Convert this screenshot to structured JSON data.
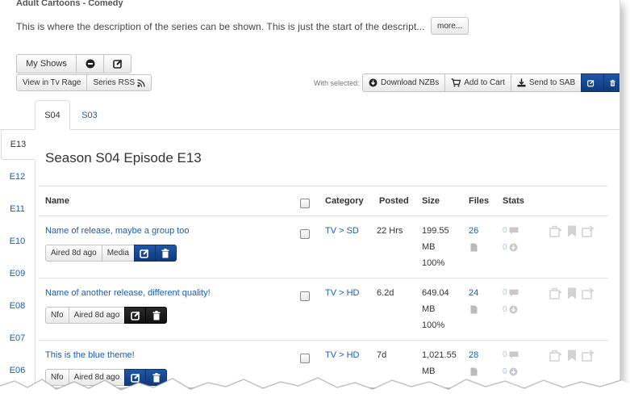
{
  "breadcrumb": "Adult Cartoons - Comedy",
  "description": "This is where the description of the series can be shown. This is just the start of the descript...",
  "more_label": "more...",
  "my_shows_label": "My Shows",
  "links": {
    "tvrage": "View in Tv Rage",
    "rss": "Series RSS"
  },
  "with_selected_label": "With selected:",
  "actions": {
    "download": "Download NZBs",
    "cart": "Add to Cart",
    "sab": "Send to SAB"
  },
  "seasons": [
    {
      "label": "S04",
      "active": true
    },
    {
      "label": "S03",
      "active": false
    }
  ],
  "episodes": [
    "E13",
    "E12",
    "E11",
    "E10",
    "E09",
    "E08",
    "E07",
    "E06"
  ],
  "active_episode": "E13",
  "heading": "Season S04 Episode E13",
  "columns": {
    "name": "Name",
    "category": "Category",
    "posted": "Posted",
    "size": "Size",
    "files": "Files",
    "stats": "Stats"
  },
  "releases": [
    {
      "name": "Name of release, maybe a group too",
      "tags": [
        "Aired 8d ago",
        "Media"
      ],
      "category": "TV > SD",
      "posted": "22 Hrs",
      "size_lines": [
        "199.55",
        "MB",
        "100%"
      ],
      "files": "26",
      "stat_a": "0",
      "stat_b": "0",
      "theme": "blue"
    },
    {
      "name": "Name of another release, different quality!",
      "tags": [
        "Nfo",
        "Aired 8d ago"
      ],
      "category": "TV > HD",
      "posted": "6.2d",
      "size_lines": [
        "649.04",
        "MB",
        "100%"
      ],
      "files": "24",
      "stat_a": "0",
      "stat_b": "0",
      "theme": "dark"
    },
    {
      "name": "This is the blue theme!",
      "tags": [
        "Nfo",
        "Aired 8d ago"
      ],
      "category": "TV > HD",
      "posted": "7d",
      "size_lines": [
        "1,021.55",
        "MB",
        ""
      ],
      "files": "28",
      "stat_a": "0",
      "stat_b": "0",
      "theme": "blue"
    }
  ],
  "colors": {
    "link": "#1a5db4",
    "blue_btn": "#1f57a8",
    "dark_btn": "#1a1a1a"
  }
}
